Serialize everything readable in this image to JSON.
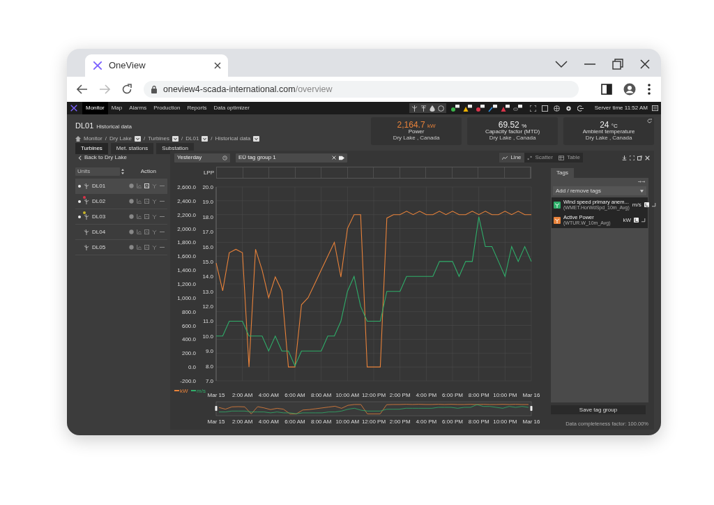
{
  "browser": {
    "tab_title": "OneView",
    "url_host": "oneview4-scada-international.com",
    "url_path": "/overview"
  },
  "nav": {
    "items": [
      {
        "label": "Monitor",
        "selected": true
      },
      {
        "label": "Map",
        "selected": false
      },
      {
        "label": "Alarms",
        "selected": false
      },
      {
        "label": "Production",
        "selected": false
      },
      {
        "label": "Reports",
        "selected": false
      },
      {
        "label": "Data optimizer",
        "selected": false
      }
    ],
    "server_time": "Server time 11:52 AM"
  },
  "page": {
    "title": "DL01",
    "subtitle": "Historical data",
    "separator": "/",
    "breadcrumb": [
      {
        "label": "Monitor",
        "dropdown": false
      },
      {
        "label": "Dry Lake",
        "dropdown": true
      },
      {
        "label": "Turbines",
        "dropdown": true
      },
      {
        "label": "DL01",
        "dropdown": true
      },
      {
        "label": "Historical data",
        "dropdown": true
      }
    ]
  },
  "kpis": [
    {
      "value": "2,164.7",
      "unit": "kW",
      "label": "Power",
      "location": "Dry Lake , Canada",
      "highlight": true
    },
    {
      "value": "69.52",
      "unit": "%",
      "label": "Capacity factor (MTD)",
      "location": "Dry Lake , Canada",
      "highlight": false
    },
    {
      "value": "24",
      "unit": "°C",
      "label": "Ambient temperature",
      "location": "Dry Lake , Canada",
      "highlight": false
    }
  ],
  "tabs": [
    {
      "label": "Turbines",
      "selected": true
    },
    {
      "label": "Met. stations",
      "selected": false
    },
    {
      "label": "Substation",
      "selected": false
    }
  ],
  "units_panel": {
    "back": "Back to Dry Lake",
    "filter_placeholder": "Units",
    "action_header": "Action",
    "units": [
      {
        "name": "DL01",
        "selected": true,
        "status_dot": true
      },
      {
        "name": "DL02",
        "selected": false,
        "status_dot": true,
        "color": "#d9344a"
      },
      {
        "name": "DL03",
        "selected": false,
        "status_dot": true,
        "color": "#c8b52a"
      },
      {
        "name": "DL04",
        "selected": false,
        "status_dot": false
      },
      {
        "name": "DL05",
        "selected": false,
        "status_dot": false
      }
    ]
  },
  "filters": {
    "period": "Yesterday",
    "tag_group": "EÜ tag group 1"
  },
  "view_modes": [
    {
      "label": "Line",
      "selected": true
    },
    {
      "label": "Scatter",
      "selected": false
    },
    {
      "label": "Table",
      "selected": false
    }
  ],
  "lpp_label": "LPP",
  "chart_data": {
    "type": "line",
    "grid": true,
    "legend": "bottom-left",
    "x": [
      0,
      0.5,
      1,
      1.5,
      2,
      2.5,
      3,
      3.5,
      4,
      4.5,
      5,
      5.5,
      6,
      6.5,
      7,
      7.5,
      8,
      8.5,
      9,
      9.5,
      10,
      10.5,
      11,
      11.5,
      12,
      12.5,
      13,
      13.5,
      14,
      14.5,
      15,
      15.5,
      16,
      16.5,
      17,
      17.5,
      18,
      18.5,
      19,
      19.5,
      20,
      20.5,
      21,
      21.5,
      22,
      22.5,
      23,
      23.5,
      24
    ],
    "xlim": [
      0,
      24
    ],
    "xticks": [
      {
        "value": 0,
        "label": "Mar 15"
      },
      {
        "value": 2,
        "label": "2:00 AM"
      },
      {
        "value": 4,
        "label": "4:00 AM"
      },
      {
        "value": 6,
        "label": "6:00 AM"
      },
      {
        "value": 8,
        "label": "8:00 AM"
      },
      {
        "value": 10,
        "label": "10:00 AM"
      },
      {
        "value": 12,
        "label": "12:00 PM"
      },
      {
        "value": 14,
        "label": "2:00 PM"
      },
      {
        "value": 16,
        "label": "4:00 PM"
      },
      {
        "value": 18,
        "label": "6:00 PM"
      },
      {
        "value": 20,
        "label": "8:00 PM"
      },
      {
        "value": 22,
        "label": "10:00 PM"
      },
      {
        "value": 24,
        "label": "Mar 16"
      }
    ],
    "ylim": [
      -200,
      2600
    ],
    "yticks": [
      {
        "value": -200,
        "label": "-200.0"
      },
      {
        "value": 0,
        "label": "0.0"
      },
      {
        "value": 200,
        "label": "200.0"
      },
      {
        "value": 400,
        "label": "400.0"
      },
      {
        "value": 600,
        "label": "600.0"
      },
      {
        "value": 800,
        "label": "800.0"
      },
      {
        "value": 1000,
        "label": "1,000.0"
      },
      {
        "value": 1200,
        "label": "1,200.0"
      },
      {
        "value": 1400,
        "label": "1,400.0"
      },
      {
        "value": 1600,
        "label": "1,600.0"
      },
      {
        "value": 1800,
        "label": "1,800.0"
      },
      {
        "value": 2000,
        "label": "2,000.0"
      },
      {
        "value": 2200,
        "label": "2,200.0"
      },
      {
        "value": 2400,
        "label": "2,400.0"
      },
      {
        "value": 2600,
        "label": "2,600.0"
      }
    ],
    "y2lim": [
      7,
      20
    ],
    "y2ticks": [
      {
        "value": 7,
        "label": "7.0"
      },
      {
        "value": 8,
        "label": "8.0"
      },
      {
        "value": 9,
        "label": "9.0"
      },
      {
        "value": 10,
        "label": "10.0"
      },
      {
        "value": 11,
        "label": "11.0"
      },
      {
        "value": 12,
        "label": "12.0"
      },
      {
        "value": 13,
        "label": "13.0"
      },
      {
        "value": 14,
        "label": "14.0"
      },
      {
        "value": 15,
        "label": "15.0"
      },
      {
        "value": 16,
        "label": "16.0"
      },
      {
        "value": 17,
        "label": "17.0"
      },
      {
        "value": 18,
        "label": "18.0"
      },
      {
        "value": 19,
        "label": "19.0"
      },
      {
        "value": 20,
        "label": "20.0"
      }
    ],
    "series": [
      {
        "name": "kW",
        "color": "#e8823a",
        "values": [
          1500,
          1100,
          1650,
          1700,
          1650,
          0,
          1700,
          1400,
          1000,
          1300,
          1100,
          0,
          0,
          900,
          1000,
          1200,
          1400,
          1600,
          1800,
          1300,
          2000,
          2200,
          2200,
          0,
          0,
          0,
          2150,
          2200,
          2200,
          2250,
          2200,
          2250,
          2200,
          2200,
          2250,
          2200,
          2250,
          2200,
          2200,
          2250,
          2200,
          2250,
          2200,
          2200,
          2250,
          2200,
          2250,
          2200,
          2200
        ]
      },
      {
        "name": "m/s",
        "color": "#2fae6a",
        "axis": "y2",
        "values": [
          10,
          10,
          11,
          11,
          11,
          10,
          10,
          10,
          9,
          10,
          9,
          9,
          8,
          9,
          9,
          9,
          9,
          10,
          10,
          11,
          13,
          14,
          12,
          11,
          11,
          11,
          13,
          13,
          13,
          14,
          14,
          14,
          14,
          14,
          15,
          15,
          15,
          14,
          15,
          15,
          18,
          16,
          16,
          15,
          14,
          16,
          15,
          16,
          15
        ]
      }
    ]
  },
  "navigator": {
    "x_labels": [
      "Mar 15",
      "2:00 AM",
      "4:00 AM",
      "6:00 AM",
      "8:00 AM",
      "10:00 AM",
      "12:00 PM",
      "2:00 PM",
      "4:00 PM",
      "6:00 PM",
      "8:00 PM",
      "10:00 PM",
      "Mar 16"
    ]
  },
  "tags_panel": {
    "tab": "Tags",
    "add_label": "Add / remove tags",
    "tags": [
      {
        "name": "Wind speed primary anem...",
        "code": "(WMET.HorWdSpd_10m_Avg)",
        "unit": "m/s",
        "color": "#2fae6a"
      },
      {
        "name": "Active Power",
        "code": "(WTUR.W_10m_Avg)",
        "unit": "kW",
        "color": "#e8823a"
      }
    ],
    "save": "Save tag group",
    "completeness": "Data completeness factor: 100.00%"
  }
}
